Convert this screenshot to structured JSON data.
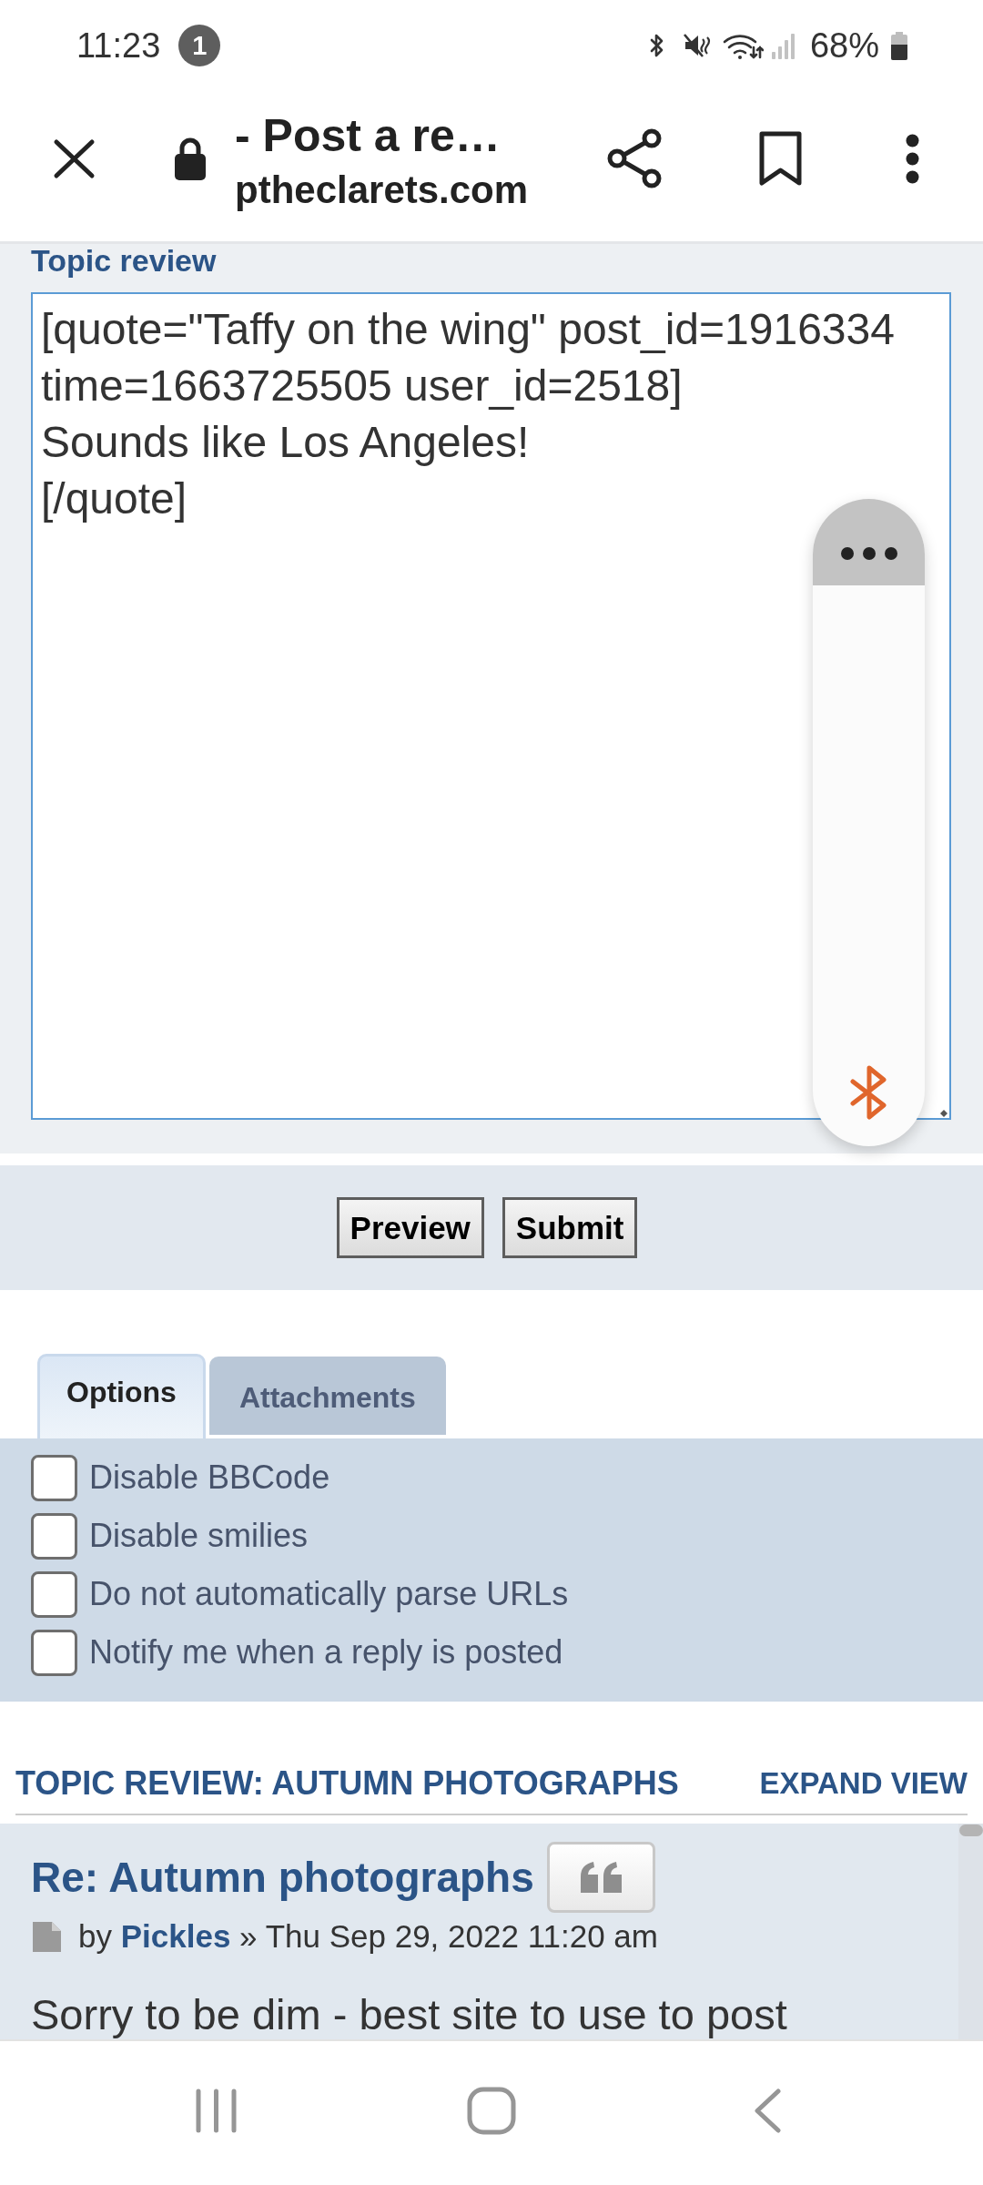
{
  "status_bar": {
    "time": "11:23",
    "notification_count": "1",
    "battery_text": "68%"
  },
  "browser_bar": {
    "title": "- Post a re…",
    "url": "ptheclarets.com"
  },
  "editor": {
    "label": "Topic review",
    "value": "[quote=\"Taffy on the wing\" post_id=1916334 time=1663725505 user_id=2518]\nSounds like Los Angeles!\n[/quote]"
  },
  "buttons": [
    {
      "label": "Preview"
    },
    {
      "label": "Submit"
    }
  ],
  "tabs": [
    {
      "label": "Options",
      "selected": true
    },
    {
      "label": "Attachments",
      "selected": false
    }
  ],
  "options": [
    {
      "label": "Disable BBCode",
      "checked": false
    },
    {
      "label": "Disable smilies",
      "checked": false
    },
    {
      "label": "Do not automatically parse URLs",
      "checked": false
    },
    {
      "label": "Notify me when a reply is posted",
      "checked": false
    }
  ],
  "topic_review": {
    "heading": "TOPIC REVIEW: AUTUMN PHOTOGRAPHS",
    "expand_link": "EXPAND VIEW",
    "posts": [
      {
        "title": "Re: Autumn photographs",
        "byline": "by",
        "author": "Pickles",
        "date": "» Thu Sep 29, 2022 11:20 am",
        "body": "Sorry to be dim - best site to use to post"
      }
    ]
  }
}
